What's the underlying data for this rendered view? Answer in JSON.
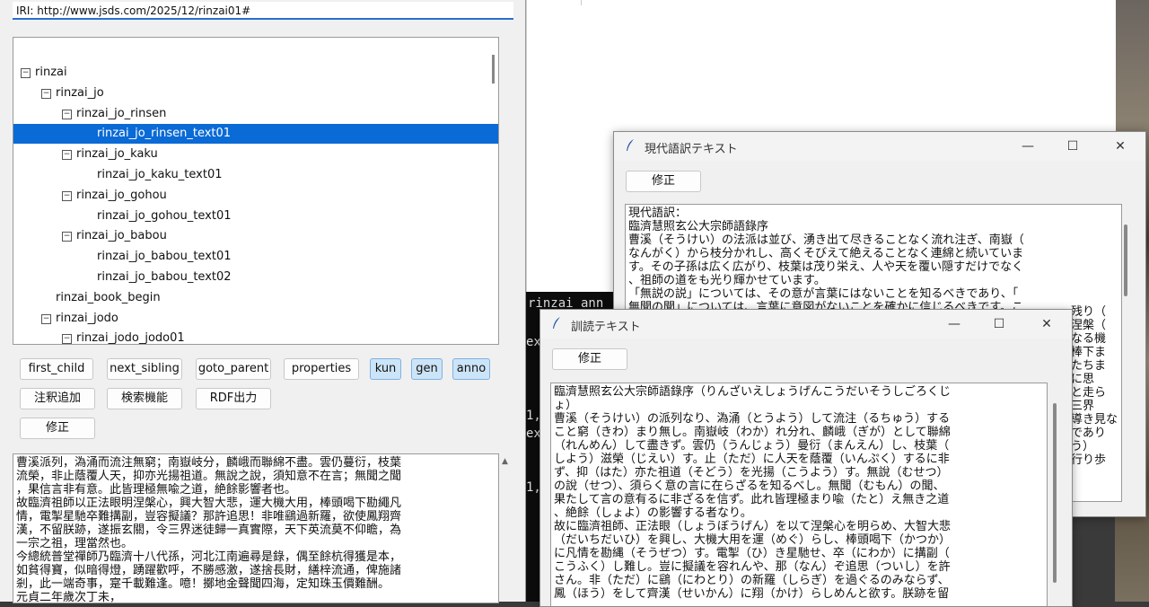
{
  "main": {
    "iri": "IRI: http://www.jsds.com/2025/12/rinzai01#",
    "tree": [
      {
        "label": "rinzai",
        "level": 0,
        "toggle": "⊟",
        "selected": false
      },
      {
        "label": "rinzai_jo",
        "level": 1,
        "toggle": "⊟",
        "selected": false
      },
      {
        "label": "rinzai_jo_rinsen",
        "level": 2,
        "toggle": "⊟",
        "selected": false
      },
      {
        "label": "rinzai_jo_rinsen_text01",
        "level": 3,
        "toggle": "",
        "selected": true
      },
      {
        "label": "rinzai_jo_kaku",
        "level": 2,
        "toggle": "⊟",
        "selected": false
      },
      {
        "label": "rinzai_jo_kaku_text01",
        "level": 3,
        "toggle": "",
        "selected": false
      },
      {
        "label": "rinzai_jo_gohou",
        "level": 2,
        "toggle": "⊟",
        "selected": false
      },
      {
        "label": "rinzai_jo_gohou_text01",
        "level": 3,
        "toggle": "",
        "selected": false
      },
      {
        "label": "rinzai_jo_babou",
        "level": 2,
        "toggle": "⊟",
        "selected": false
      },
      {
        "label": "rinzai_jo_babou_text01",
        "level": 3,
        "toggle": "",
        "selected": false
      },
      {
        "label": "rinzai_jo_babou_text02",
        "level": 3,
        "toggle": "",
        "selected": false
      },
      {
        "label": "rinzai_book_begin",
        "level": 1,
        "toggle": "",
        "selected": false
      },
      {
        "label": "rinzai_jodo",
        "level": 1,
        "toggle": "⊟",
        "selected": false
      },
      {
        "label": "rinzai_jodo_jodo01",
        "level": 2,
        "toggle": "⊟",
        "selected": false
      }
    ],
    "buttons": {
      "first_child": "first_child",
      "next_sibling": "next_sibling",
      "goto_parent": "goto_parent",
      "properties": "properties",
      "kun": "kun",
      "gen": "gen",
      "anno": "anno",
      "add_note": "注釈追加",
      "search": "検索機能",
      "rdf_output": "RDF出力",
      "edit": "修正"
    },
    "text_lines": [
      "曹溪派列，溈涌而流注無窮；南嶽岐分，麟峨而聯綿不盡。雲仍蔓衍，枝葉",
      "流榮，非止蔭覆人天，抑亦光揚祖道。無說之說，須知意不在言；無聞之聞",
      "，果信言非有意。此皆理極無喩之道，絶餘影響者也。",
      "故臨濟祖師以正法眼明涅槃心，興大智大悲，運大機大用，棒頭喝下勘繩凡",
      "情，電掣星馳卒難搆副，豈容擬議？那許追思！非唯鷂過新羅，欲使鳳翔齊",
      "漢，不留朕跡，遂振玄關，令三界迷徒歸一真實際，天下英流莫不仰瞻，為",
      "一宗之祖，理當然也。",
      "今總統普堂禪師乃臨濟十八代孫，河北江南遍尋是錄，偶至餘杭得獲是本，",
      "如貧得寶，似暗得燈，踴躍歡呼，不勝感激，遂捨長財，繕梓流通，俾施諸",
      "剎，此一端奇事，寔千載難逢。噫！擲地金聲聞四海，定知珠玉價難酬。",
      "元貞二年歲次丁未，"
    ]
  },
  "gendai": {
    "title": "現代語訳テキスト",
    "edit_label": "修正",
    "min": "—",
    "max": "☐",
    "close": "✕",
    "text_lines": [
      "現代語訳：",
      "臨濟慧照玄公大宗師語錄序",
      "曹溪（そうけい）の法派は並び、湧き出て尽きることなく流れ注ぎ、南嶽（",
      "なんがく）から枝分かれし、高くそびえて絶えることなく連綿と続いていま",
      "す。その子孫は広く広がり、枝葉は茂り栄え、人や天を覆い隠すだけでなく",
      "、祖師の道をも光り輝かせています。",
      "「無説の説」については、その意が言葉にはないことを知るべきであり、「",
      "無聞の聞」については、言葉に意図がないことを確かに信じるべきです。こ"
    ],
    "right_fragments": [
      "残り（",
      "涅槃（",
      "なる機",
      "棒下ま",
      "たちま",
      "に思",
      "と走ら",
      "三界",
      "導き見な",
      "であり",
      "う）",
      "行り歩"
    ]
  },
  "kundoku": {
    "title": "訓読テキスト",
    "edit_label": "修正",
    "min": "—",
    "max": "☐",
    "close": "✕",
    "text_lines": [
      "臨濟慧照玄公大宗師語錄序（りんざいえしょうげんこうだいそうしごろくじ",
      "ょ）",
      "曹溪（そうけい）の派列なり、溈涌（とうよう）して流注（るちゅう）する",
      "こと窮（きわ）まり無し。南嶽岐（わか）れ分れ、麟峨（ぎが）として聯綿",
      "（れんめん）して盡きず。雲仍（うんじょう）曼衍（まんえん）し、枝葉（",
      "しよう）滋榮（じえい）す。止（ただ）に人天を蔭覆（いんぷく）するに非",
      "ず、抑（はた）亦た祖道（そどう）を光揚（こうよう）す。無說（むせつ）",
      "の說（せつ）、須らく意の言に在らざるを知るべし。無聞（むもん）の聞、",
      "果たして言の意有るに非ざるを信ず。此れ皆理極まり喩（たと）え無き之道",
      "、絶餘（しょよ）の影響する者なり。",
      "故に臨濟祖師、正法眼（しょうぼうげん）を以て涅槃心を明らめ、大智大悲",
      "（だいちだいひ）を興し、大機大用を運（めぐ）らし、棒頭喝下（かつか）",
      "に凡情を勘縄（そうぜつ）す。電掣（ひ）き星馳せ、卒（にわか）に搆副（",
      "こうふく）し難し。豈に擬議を容れんや、那（なん）ぞ追思（ついし）を許",
      "さん。非（ただ）に鷂（にわとり）の新羅（しらぎ）を過ぐるのみならず、",
      "鳳（ほう）をして齊漢（せいかん）に翔（かけ）らしめんと欲す。朕跡を留"
    ]
  },
  "console": {
    "lines": [
      "rinzai_ann",
      "ex",
      "1,",
      "ex",
      "1,"
    ]
  }
}
